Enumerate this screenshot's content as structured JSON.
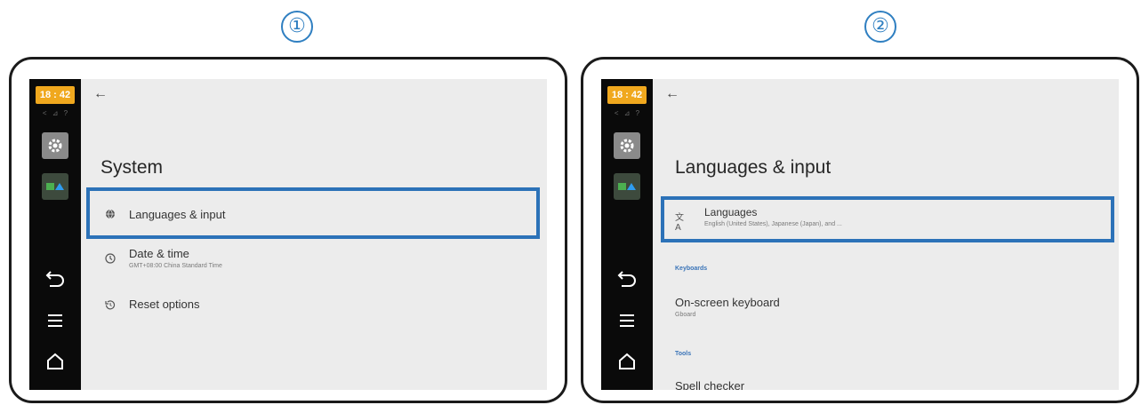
{
  "steps": [
    "①",
    "②"
  ],
  "colors": {
    "accent": "#2c72b8",
    "clock_bg": "#f0a81e",
    "sidebar_bg": "#0a0a0a",
    "screen_bg": "#ececec"
  },
  "sidebar": {
    "clock": "18 : 42",
    "status_icons": "< ⊿ ?",
    "apps": [
      "gear-icon",
      "gallery-icon"
    ],
    "nav": [
      "back-icon",
      "menu-icon",
      "home-icon"
    ]
  },
  "screen1": {
    "title": "System",
    "items": [
      {
        "title": "Languages & input",
        "icon": "globe-icon"
      },
      {
        "title": "Date & time",
        "subtitle": "GMT+08:00 China Standard Time",
        "icon": "clock-icon"
      },
      {
        "title": "Reset options",
        "icon": "history-icon"
      }
    ]
  },
  "screen2": {
    "title": "Languages & input",
    "languages": {
      "title": "Languages",
      "subtitle": "English (United States), Japanese (Japan), and ...",
      "icon": "translate-icon"
    },
    "keyboards_header": "Keyboards",
    "onscreen": {
      "title": "On-screen keyboard",
      "subtitle": "Gboard"
    },
    "tools_header": "Tools",
    "spell": {
      "title": "Spell checker"
    }
  }
}
